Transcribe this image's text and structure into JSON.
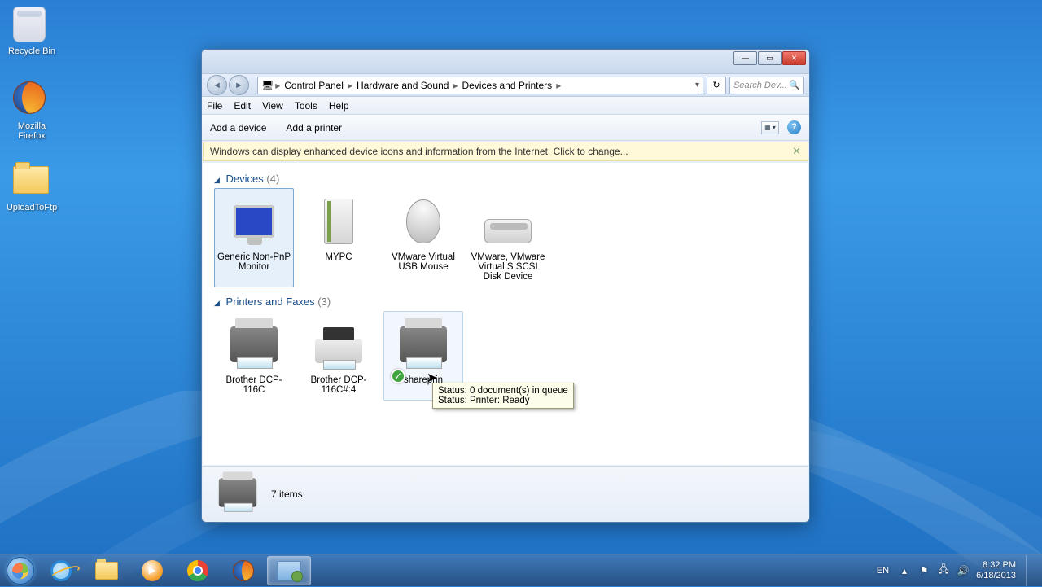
{
  "desktop": {
    "recycle": "Recycle Bin",
    "firefox": "Mozilla Firefox",
    "upload": "UploadToFtp"
  },
  "window": {
    "breadcrumb": [
      "Control Panel",
      "Hardware and Sound",
      "Devices and Printers"
    ],
    "search_placeholder": "Search Dev...",
    "menu": {
      "file": "File",
      "edit": "Edit",
      "view": "View",
      "tools": "Tools",
      "help": "Help"
    },
    "toolbar": {
      "add_device": "Add a device",
      "add_printer": "Add a printer"
    },
    "info_bar": "Windows can display enhanced device icons and information from the Internet. Click to change...",
    "groups": {
      "devices": {
        "title": "Devices",
        "count": "(4)",
        "items": [
          {
            "name": "Generic Non-PnP Monitor"
          },
          {
            "name": "MYPC"
          },
          {
            "name": "VMware Virtual USB Mouse"
          },
          {
            "name": "VMware, VMware Virtual S SCSI Disk Device"
          }
        ]
      },
      "printers": {
        "title": "Printers and Faxes",
        "count": "(3)",
        "items": [
          {
            "name": "Brother DCP-116C"
          },
          {
            "name": "Brother DCP-116C#:4"
          },
          {
            "name": "shareprin"
          }
        ]
      }
    },
    "status": {
      "count": "7 items"
    },
    "tooltip": {
      "line1": "Status: 0 document(s) in queue",
      "line2": "Status: Printer:  Ready"
    }
  },
  "taskbar": {
    "lang": "EN",
    "time": "8:32 PM",
    "date": "6/18/2013"
  }
}
